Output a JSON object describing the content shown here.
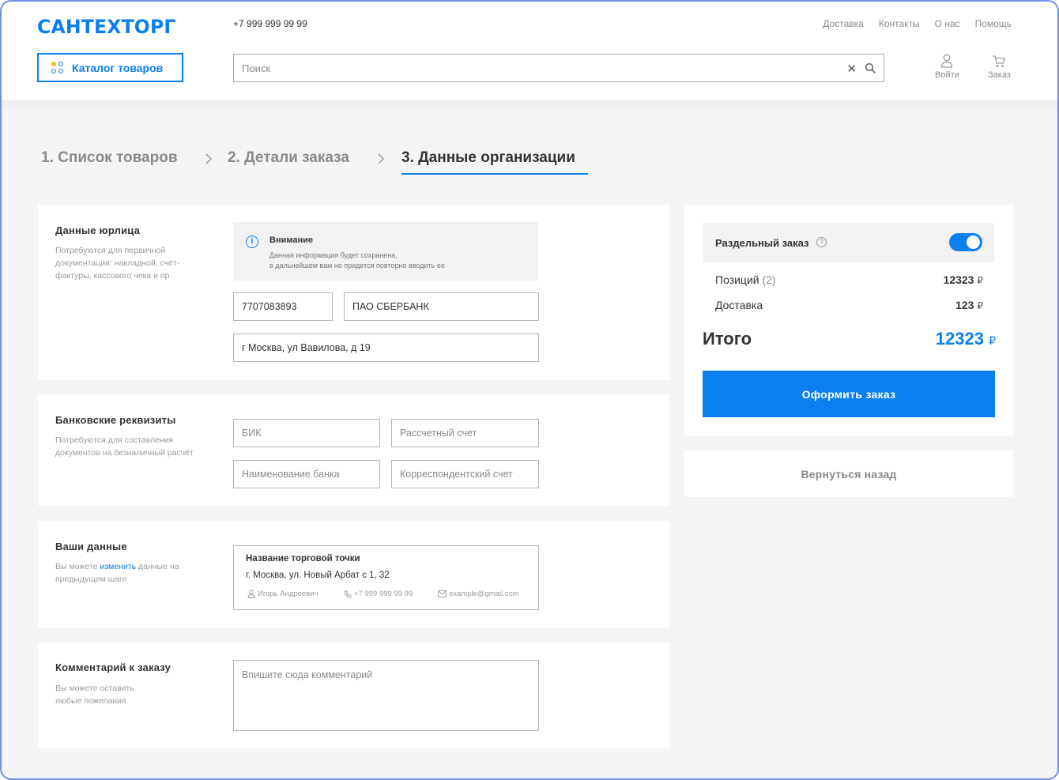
{
  "header": {
    "logo": "САНТЕХТОРГ",
    "phone": "+7 999 999 99 99",
    "nav": [
      "Доставка",
      "Контакты",
      "О нас",
      "Помощь"
    ],
    "catalog_label": "Каталог товаров",
    "search_placeholder": "Поиск",
    "login_label": "Войти",
    "order_label": "Заказ"
  },
  "steps": [
    {
      "label": "1. Список товаров",
      "active": false
    },
    {
      "label": "2. Детали заказа",
      "active": false
    },
    {
      "label": "3. Данные организации",
      "active": true
    }
  ],
  "legal": {
    "title": "Данные юрлица",
    "desc": "Потребуются для первичной документации: накладной, счёт-фактуры, кассового чека и пр.",
    "notice_title": "Внимание",
    "notice_line1": "Данная информация будет сохранена,",
    "notice_line2": "в дальнейшем вам не придется повторно вводить ее",
    "inn": "7707083893",
    "org_name": "ПАО СБЕРБАНК",
    "address": "г Москва, ул Вавилова, д 19"
  },
  "bank": {
    "title": "Банковские реквизиты",
    "desc": "Потребуются для составления документов на безналичный расчёт",
    "bik_placeholder": "БИК",
    "account_placeholder": "Рассчетный счет",
    "bank_name_placeholder": "Наименование банка",
    "corr_placeholder": "Корреспондентский счет"
  },
  "your_data": {
    "title": "Ваши данные",
    "desc_before": "Вы можете ",
    "desc_link": "изменить",
    "desc_after": " данные на предыдущем шаге",
    "store_name": "Название торговой точки",
    "store_address": "г. Москва, ул. Новый Арбат с 1, 32",
    "person": "Игорь Андреевич",
    "phone": "+7 999 999 99 99",
    "email": "example@gmail.com"
  },
  "comment": {
    "title": "Комментарий к заказу",
    "desc": "Вы можете оставить любые пожелания",
    "placeholder": "Впишите сюда комментарий"
  },
  "summary": {
    "split_label": "Раздельный заказ",
    "split_enabled": true,
    "positions_label": "Позиций",
    "positions_count": "(2)",
    "positions_value": "12323",
    "delivery_label": "Доставка",
    "delivery_value": "123",
    "currency": "₽",
    "total_label": "Итого",
    "total_value": "12323",
    "order_button": "Оформить заказ",
    "back_button": "Вернуться назад"
  },
  "colors": {
    "accent": "#0a7ff0",
    "muted": "#8a8a8a",
    "background": "#f5f5f5"
  }
}
